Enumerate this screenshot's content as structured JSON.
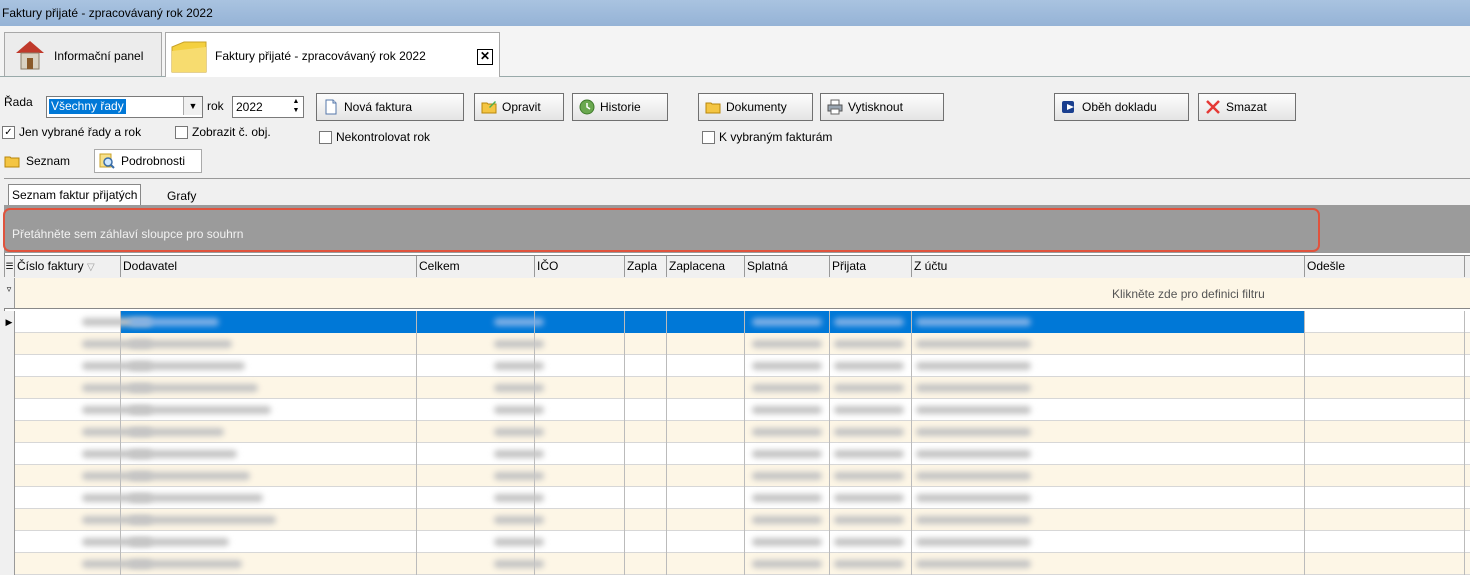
{
  "window": {
    "title": "Faktury přijaté - zpracovávaný rok 2022"
  },
  "tabs": [
    {
      "label": "Informační panel"
    },
    {
      "label": "Faktury přijaté - zpracovávaný rok 2022",
      "close": "✕"
    }
  ],
  "filters": {
    "rada_label": "Řada",
    "rada_value": "Všechny řady",
    "rok_label": "rok",
    "rok_value": "2022",
    "jen_vybrane": "Jen vybrané řady a rok",
    "zobrazit_obj": "Zobrazit č. obj.",
    "nekontrolovat": "Nekontrolovat rok",
    "k_vybranym": "K vybraným fakturám"
  },
  "toolbar": {
    "nova": "Nová faktura",
    "opravit": "Opravit",
    "historie": "Historie",
    "dokumenty": "Dokumenty",
    "vytisknout": "Vytisknout",
    "obeh": "Oběh dokladu",
    "smazat": "Smazat"
  },
  "view_tabs": {
    "seznam": "Seznam",
    "podrobnosti": "Podrobnosti"
  },
  "sub_tabs": {
    "seznam_faktur": "Seznam faktur přijatých",
    "grafy": "Grafy"
  },
  "grid": {
    "group_hint": "Přetáhněte sem záhlaví sloupce pro souhrn",
    "filter_hint": "Klikněte zde pro definici filtru",
    "columns": [
      "Číslo faktury",
      "Dodavatel",
      "Celkem",
      "IČO",
      "Zapla",
      "Zaplacena",
      "Splatná",
      "Přijata",
      "Z účtu",
      "Odešle"
    ],
    "row_tail": [
      "",
      "",
      "",
      "",
      "",
      "",
      "",
      "",
      "",
      ""
    ]
  },
  "colors": {
    "selection": "#0078d7",
    "accent_red": "#e0533d",
    "row_alt": "#fdf6e6"
  }
}
